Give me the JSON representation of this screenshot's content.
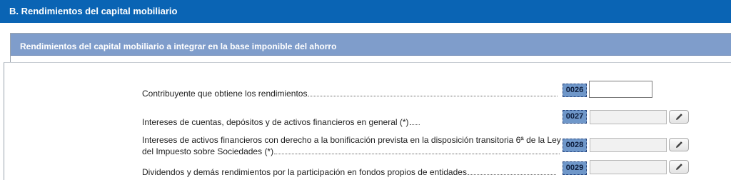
{
  "section": {
    "title": "B.  Rendimientos del capital mobiliario"
  },
  "subsection": {
    "title": "Rendimientos del capital mobiliario a integrar en la base imponible del ahorro"
  },
  "rows": [
    {
      "label": "Contribuyente que obtiene los rendimientos",
      "code": "0026",
      "value": ""
    },
    {
      "label": "Intereses de cuentas, depósitos y de activos financieros en general (*)",
      "code": "0027",
      "value": ""
    },
    {
      "label_line1": "Intereses de activos financieros con derecho a la bonificación prevista en la disposición transitoria 6ª de la Ley",
      "label_line2": "del Impuesto sobre Sociedades (*)",
      "code": "0028",
      "value": ""
    },
    {
      "label": "Dividendos y demás rendimientos por la participación en fondos propios de entidades",
      "code": "0029",
      "value": ""
    }
  ],
  "icons": {
    "edit": "pencil-icon"
  },
  "colors": {
    "header_blue": "#0a64b4",
    "subheader_blue": "#7f9dcb",
    "code_badge": "#6f97c9"
  }
}
